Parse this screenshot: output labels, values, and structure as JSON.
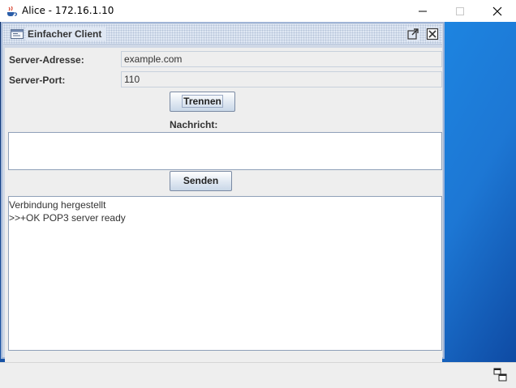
{
  "window": {
    "title": "Alice - 172.16.1.10",
    "icon": "java-cup-icon"
  },
  "internal_frame": {
    "title": "Einfacher Client",
    "icons": [
      "frame-icon",
      "restore-icon",
      "close-icon"
    ]
  },
  "form": {
    "server_address_label": "Server-Adresse:",
    "server_address_value": "example.com",
    "server_port_label": "Server-Port:",
    "server_port_value": "110",
    "disconnect_button": "Trennen",
    "message_label": "Nachricht:",
    "message_value": "",
    "send_button": "Senden"
  },
  "log": {
    "lines": [
      "Verbindung hergestellt",
      ">>+OK POP3 server ready"
    ]
  },
  "colors": {
    "accent": "#9fb4d6",
    "desktop": "#1d86e2"
  }
}
